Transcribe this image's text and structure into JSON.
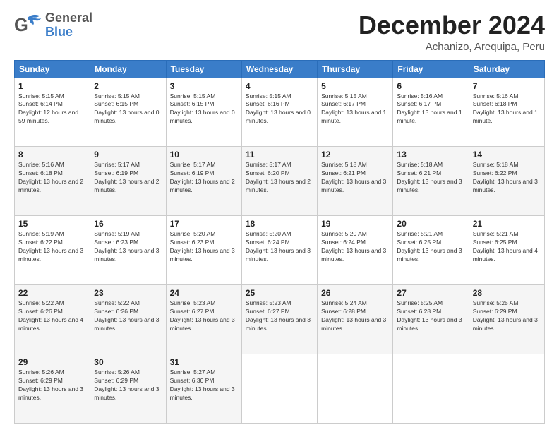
{
  "header": {
    "logo": {
      "general": "General",
      "blue": "Blue"
    },
    "title": "December 2024",
    "location": "Achanizo, Arequipa, Peru"
  },
  "calendar": {
    "days": [
      "Sunday",
      "Monday",
      "Tuesday",
      "Wednesday",
      "Thursday",
      "Friday",
      "Saturday"
    ],
    "rows": [
      [
        {
          "day": "1",
          "sunrise": "Sunrise: 5:15 AM",
          "sunset": "Sunset: 6:14 PM",
          "daylight": "Daylight: 12 hours and 59 minutes."
        },
        {
          "day": "2",
          "sunrise": "Sunrise: 5:15 AM",
          "sunset": "Sunset: 6:15 PM",
          "daylight": "Daylight: 13 hours and 0 minutes."
        },
        {
          "day": "3",
          "sunrise": "Sunrise: 5:15 AM",
          "sunset": "Sunset: 6:15 PM",
          "daylight": "Daylight: 13 hours and 0 minutes."
        },
        {
          "day": "4",
          "sunrise": "Sunrise: 5:15 AM",
          "sunset": "Sunset: 6:16 PM",
          "daylight": "Daylight: 13 hours and 0 minutes."
        },
        {
          "day": "5",
          "sunrise": "Sunrise: 5:15 AM",
          "sunset": "Sunset: 6:17 PM",
          "daylight": "Daylight: 13 hours and 1 minute."
        },
        {
          "day": "6",
          "sunrise": "Sunrise: 5:16 AM",
          "sunset": "Sunset: 6:17 PM",
          "daylight": "Daylight: 13 hours and 1 minute."
        },
        {
          "day": "7",
          "sunrise": "Sunrise: 5:16 AM",
          "sunset": "Sunset: 6:18 PM",
          "daylight": "Daylight: 13 hours and 1 minute."
        }
      ],
      [
        {
          "day": "8",
          "sunrise": "Sunrise: 5:16 AM",
          "sunset": "Sunset: 6:18 PM",
          "daylight": "Daylight: 13 hours and 2 minutes."
        },
        {
          "day": "9",
          "sunrise": "Sunrise: 5:17 AM",
          "sunset": "Sunset: 6:19 PM",
          "daylight": "Daylight: 13 hours and 2 minutes."
        },
        {
          "day": "10",
          "sunrise": "Sunrise: 5:17 AM",
          "sunset": "Sunset: 6:19 PM",
          "daylight": "Daylight: 13 hours and 2 minutes."
        },
        {
          "day": "11",
          "sunrise": "Sunrise: 5:17 AM",
          "sunset": "Sunset: 6:20 PM",
          "daylight": "Daylight: 13 hours and 2 minutes."
        },
        {
          "day": "12",
          "sunrise": "Sunrise: 5:18 AM",
          "sunset": "Sunset: 6:21 PM",
          "daylight": "Daylight: 13 hours and 3 minutes."
        },
        {
          "day": "13",
          "sunrise": "Sunrise: 5:18 AM",
          "sunset": "Sunset: 6:21 PM",
          "daylight": "Daylight: 13 hours and 3 minutes."
        },
        {
          "day": "14",
          "sunrise": "Sunrise: 5:18 AM",
          "sunset": "Sunset: 6:22 PM",
          "daylight": "Daylight: 13 hours and 3 minutes."
        }
      ],
      [
        {
          "day": "15",
          "sunrise": "Sunrise: 5:19 AM",
          "sunset": "Sunset: 6:22 PM",
          "daylight": "Daylight: 13 hours and 3 minutes."
        },
        {
          "day": "16",
          "sunrise": "Sunrise: 5:19 AM",
          "sunset": "Sunset: 6:23 PM",
          "daylight": "Daylight: 13 hours and 3 minutes."
        },
        {
          "day": "17",
          "sunrise": "Sunrise: 5:20 AM",
          "sunset": "Sunset: 6:23 PM",
          "daylight": "Daylight: 13 hours and 3 minutes."
        },
        {
          "day": "18",
          "sunrise": "Sunrise: 5:20 AM",
          "sunset": "Sunset: 6:24 PM",
          "daylight": "Daylight: 13 hours and 3 minutes."
        },
        {
          "day": "19",
          "sunrise": "Sunrise: 5:20 AM",
          "sunset": "Sunset: 6:24 PM",
          "daylight": "Daylight: 13 hours and 3 minutes."
        },
        {
          "day": "20",
          "sunrise": "Sunrise: 5:21 AM",
          "sunset": "Sunset: 6:25 PM",
          "daylight": "Daylight: 13 hours and 3 minutes."
        },
        {
          "day": "21",
          "sunrise": "Sunrise: 5:21 AM",
          "sunset": "Sunset: 6:25 PM",
          "daylight": "Daylight: 13 hours and 4 minutes."
        }
      ],
      [
        {
          "day": "22",
          "sunrise": "Sunrise: 5:22 AM",
          "sunset": "Sunset: 6:26 PM",
          "daylight": "Daylight: 13 hours and 4 minutes."
        },
        {
          "day": "23",
          "sunrise": "Sunrise: 5:22 AM",
          "sunset": "Sunset: 6:26 PM",
          "daylight": "Daylight: 13 hours and 3 minutes."
        },
        {
          "day": "24",
          "sunrise": "Sunrise: 5:23 AM",
          "sunset": "Sunset: 6:27 PM",
          "daylight": "Daylight: 13 hours and 3 minutes."
        },
        {
          "day": "25",
          "sunrise": "Sunrise: 5:23 AM",
          "sunset": "Sunset: 6:27 PM",
          "daylight": "Daylight: 13 hours and 3 minutes."
        },
        {
          "day": "26",
          "sunrise": "Sunrise: 5:24 AM",
          "sunset": "Sunset: 6:28 PM",
          "daylight": "Daylight: 13 hours and 3 minutes."
        },
        {
          "day": "27",
          "sunrise": "Sunrise: 5:25 AM",
          "sunset": "Sunset: 6:28 PM",
          "daylight": "Daylight: 13 hours and 3 minutes."
        },
        {
          "day": "28",
          "sunrise": "Sunrise: 5:25 AM",
          "sunset": "Sunset: 6:29 PM",
          "daylight": "Daylight: 13 hours and 3 minutes."
        }
      ],
      [
        {
          "day": "29",
          "sunrise": "Sunrise: 5:26 AM",
          "sunset": "Sunset: 6:29 PM",
          "daylight": "Daylight: 13 hours and 3 minutes."
        },
        {
          "day": "30",
          "sunrise": "Sunrise: 5:26 AM",
          "sunset": "Sunset: 6:29 PM",
          "daylight": "Daylight: 13 hours and 3 minutes."
        },
        {
          "day": "31",
          "sunrise": "Sunrise: 5:27 AM",
          "sunset": "Sunset: 6:30 PM",
          "daylight": "Daylight: 13 hours and 3 minutes."
        },
        null,
        null,
        null,
        null
      ]
    ]
  }
}
